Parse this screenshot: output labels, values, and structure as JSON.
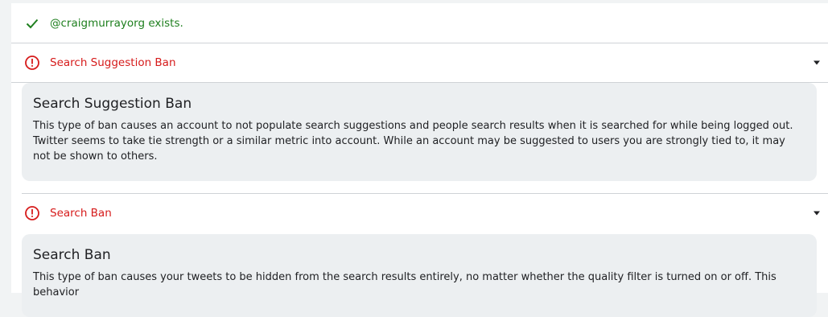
{
  "status": {
    "exists_text": "@craigmurrayorg exists."
  },
  "sections": [
    {
      "header": "Search Suggestion Ban",
      "title": "Search Suggestion Ban",
      "description": "This type of ban causes an account to not populate search suggestions and people search results when it is searched for while being logged out. Twitter seems to take tie strength or a similar metric into account. While an account may be suggested to users you are strongly tied to, it may not be shown to others."
    },
    {
      "header": "Search Ban",
      "title": "Search Ban",
      "description": "This type of ban causes your tweets to be hidden from the search results entirely, no matter whether the quality filter is turned on or off. This behavior"
    }
  ],
  "icons": {
    "exists": "check-icon",
    "ban": "alert-circle-icon",
    "expand": "caret-down-icon"
  },
  "colors": {
    "success": "#1e7f1e",
    "error": "#d61b1b",
    "card_background": "#eceff1"
  }
}
